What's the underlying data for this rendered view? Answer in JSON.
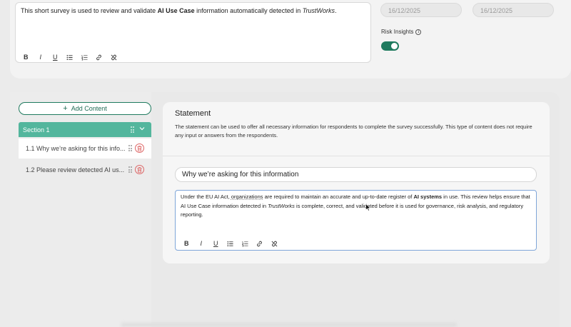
{
  "top_editor": {
    "text_before": "This short survey is used to review and validate ",
    "text_bold": "AI Use Case",
    "text_middle": " information automatically detected in ",
    "text_italic": "TrustWorks",
    "text_end": "."
  },
  "toolbar": {
    "bold": "B",
    "italic": "I",
    "underline": "U"
  },
  "dates": {
    "start": "16/12/2025",
    "end": "16/12/2025"
  },
  "risk_insights": {
    "label": "Risk Insights",
    "info": "i",
    "enabled": true
  },
  "sidebar": {
    "add_content_label": "Add Content",
    "add_icon": "+",
    "section_title": "Section 1",
    "items": [
      {
        "label": "1.1 Why we’re asking for this info..."
      },
      {
        "label": "1.2 Please review detected AI us..."
      }
    ]
  },
  "statement": {
    "title": "Statement",
    "description": "The statement can be used to offer all necessary information for respondents to complete the survey successfully. This type of content does not require any input or answers from the respondents.",
    "question_title": "Why we’re asking for this information",
    "body": {
      "p1": "Under the EU AI Act, ",
      "p1_u": "organizations",
      "p2": " are required to maintain an accurate and up-to-date register of ",
      "p2_bold": "AI systems",
      "p3": " in use. This review helps ensure that AI Use Case information detected in ",
      "p3_italic": "TrustWorks",
      "p4": " is complete, correct, and validated before it is used for governance, risk analysis, and regulatory reporting."
    }
  },
  "colors": {
    "accent": "#1f7a5e",
    "section": "#53b69d",
    "danger": "#d66666"
  }
}
